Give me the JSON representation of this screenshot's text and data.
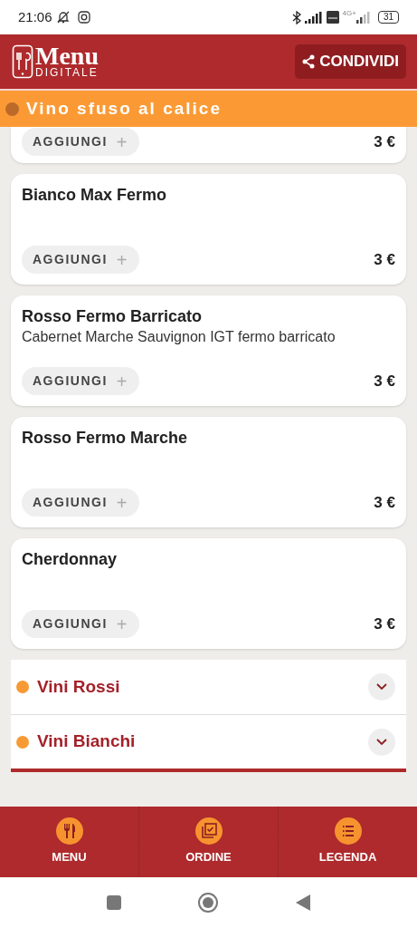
{
  "status_bar": {
    "time": "21:06",
    "network": "4G+",
    "battery": "31"
  },
  "header": {
    "logo_title": "Menu",
    "logo_subtitle": "DIGITALE",
    "share_button": "CONDIVIDI"
  },
  "current_section": {
    "title": "Vino sfuso al calice"
  },
  "items": [
    {
      "add_label": "AGGIUNGI",
      "add_icon": "+",
      "price": "3 €"
    },
    {
      "name": "Bianco Max Fermo",
      "add_label": "AGGIUNGI",
      "add_icon": "+",
      "price": "3 €"
    },
    {
      "name": "Rosso Fermo Barricato",
      "description": "Cabernet Marche Sauvignon IGT fermo barricato",
      "add_label": "AGGIUNGI",
      "add_icon": "+",
      "price": "3 €"
    },
    {
      "name": "Rosso Fermo Marche",
      "add_label": "AGGIUNGI",
      "add_icon": "+",
      "price": "3 €"
    },
    {
      "name": "Cherdonnay",
      "add_label": "AGGIUNGI",
      "add_icon": "+",
      "price": "3 €"
    }
  ],
  "categories": [
    {
      "title": "Vini Rossi",
      "expanded": false
    },
    {
      "title": "Vini Bianchi",
      "expanded": false
    }
  ],
  "bottom_nav": [
    {
      "kind": "menu",
      "label": "MENU"
    },
    {
      "kind": "order",
      "label": "ORDINE"
    },
    {
      "kind": "legend",
      "label": "LEGENDA"
    }
  ]
}
